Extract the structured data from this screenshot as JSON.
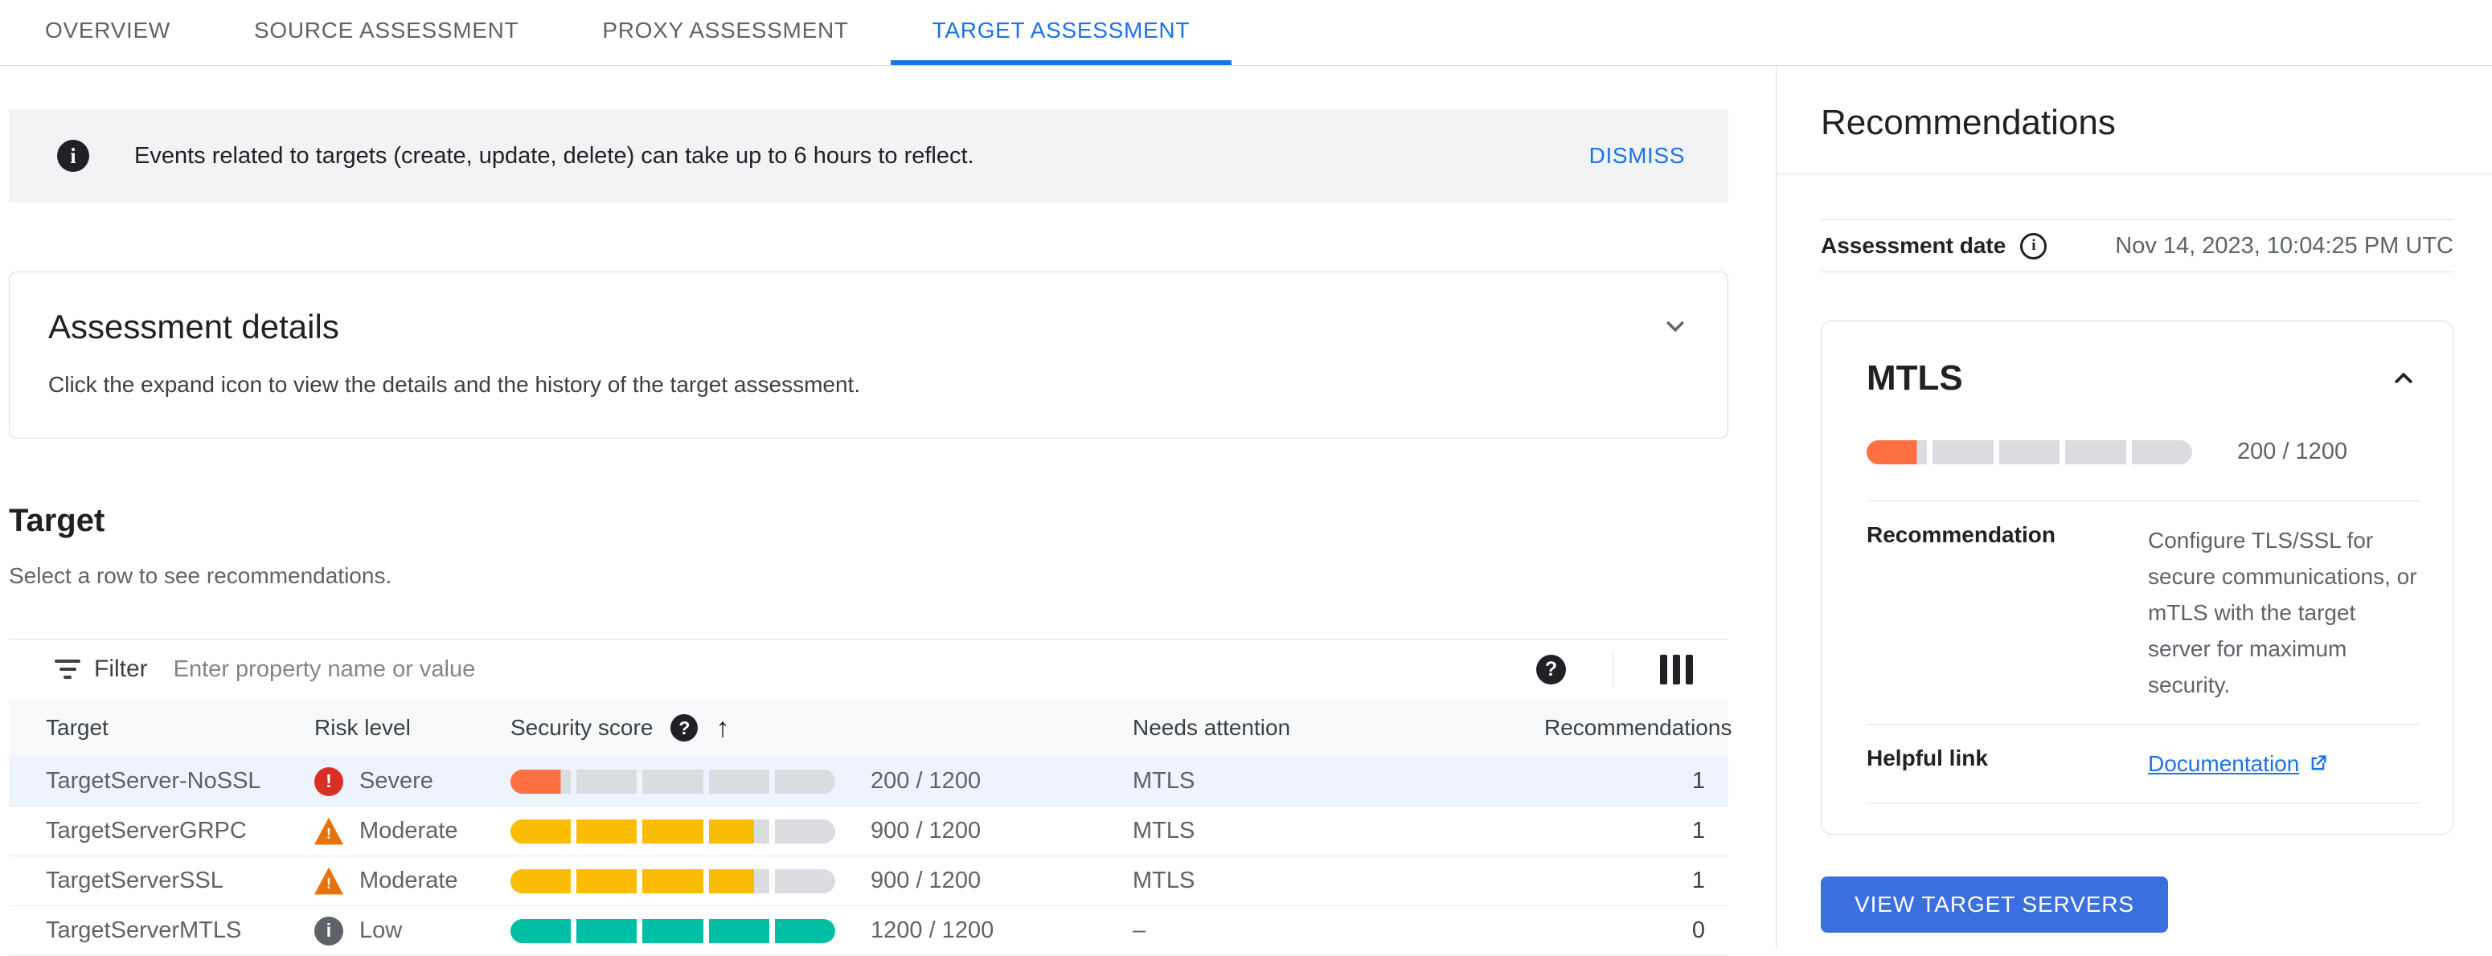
{
  "tabs": {
    "items": [
      {
        "label": "OVERVIEW",
        "active": false
      },
      {
        "label": "SOURCE ASSESSMENT",
        "active": false
      },
      {
        "label": "PROXY ASSESSMENT",
        "active": false
      },
      {
        "label": "TARGET ASSESSMENT",
        "active": true
      }
    ]
  },
  "banner": {
    "text": "Events related to targets (create, update, delete) can take up to 6 hours to reflect.",
    "dismiss_label": "DISMISS"
  },
  "assessment_details": {
    "title": "Assessment details",
    "caption": "Click the expand icon to view the details and the history of the target assessment."
  },
  "target_section": {
    "title": "Target",
    "caption": "Select a row to see recommendations."
  },
  "filter_bar": {
    "label": "Filter",
    "placeholder": "Enter property name or value"
  },
  "table": {
    "columns": {
      "target": "Target",
      "risk_level": "Risk level",
      "security_score": "Security score",
      "needs_attention": "Needs attention",
      "recommendations": "Recommendations"
    },
    "rows": [
      {
        "target": "TargetServer-NoSSL",
        "risk_label": "Severe",
        "risk_level": "severe",
        "score_label": "200 / 1200",
        "score_value": 200,
        "score_max": 1200,
        "bar_color": "#ff7043",
        "needs_attention": "MTLS",
        "recommendations": "1",
        "selected": true
      },
      {
        "target": "TargetServerGRPC",
        "risk_label": "Moderate",
        "risk_level": "moderate",
        "score_label": "900 / 1200",
        "score_value": 900,
        "score_max": 1200,
        "bar_color": "#fbbc04",
        "needs_attention": "MTLS",
        "recommendations": "1",
        "selected": false
      },
      {
        "target": "TargetServerSSL",
        "risk_label": "Moderate",
        "risk_level": "moderate",
        "score_label": "900 / 1200",
        "score_value": 900,
        "score_max": 1200,
        "bar_color": "#fbbc04",
        "needs_attention": "MTLS",
        "recommendations": "1",
        "selected": false
      },
      {
        "target": "TargetServerMTLS",
        "risk_label": "Low",
        "risk_level": "low",
        "score_label": "1200 / 1200",
        "score_value": 1200,
        "score_max": 1200,
        "bar_color": "#00bfa5",
        "needs_attention": "–",
        "recommendations": "0",
        "selected": false
      }
    ]
  },
  "recommendations_panel": {
    "title": "Recommendations",
    "assessment_date_label": "Assessment date",
    "assessment_date_value": "Nov 14, 2023, 10:04:25 PM UTC",
    "mtls_card": {
      "title": "MTLS",
      "score_label": "200 / 1200",
      "score_value": 200,
      "score_max": 1200,
      "bar_color": "#ff7043",
      "recommendation_label": "Recommendation",
      "recommendation_text": "Configure TLS/SSL for secure communications, or mTLS with the target server for maximum security.",
      "helpful_link_label": "Helpful link",
      "link_text": "Documentation"
    },
    "button_label": "VIEW TARGET SERVERS"
  },
  "colors": {
    "accent": "#1a73e8",
    "button": "#3b6fe0",
    "severe": "#d93025",
    "moderate": "#e8710a",
    "low": "#5f6368",
    "bar_track": "#dadce0",
    "selected_row": "#eef3fd"
  }
}
